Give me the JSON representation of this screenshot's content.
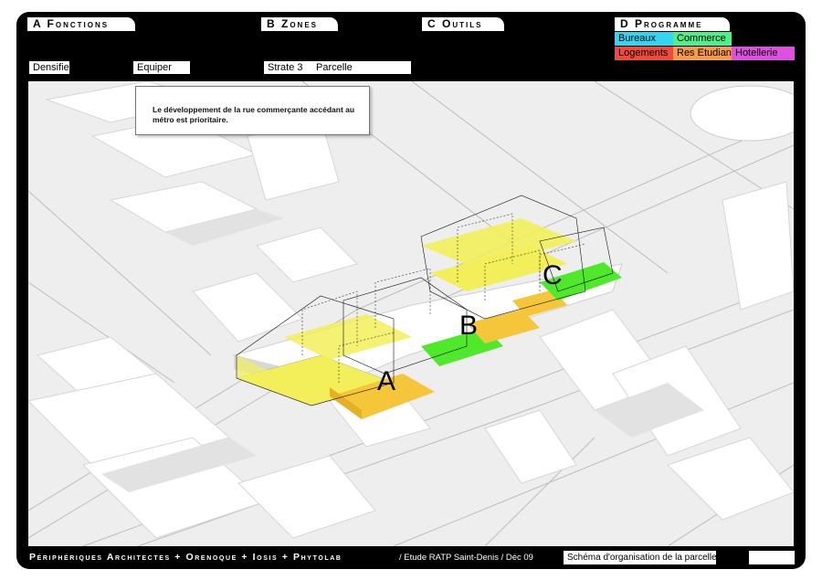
{
  "tabs": {
    "a": "A Fonctions",
    "b": "B Zones",
    "c": "C Outils",
    "d": "D Programme"
  },
  "fields": {
    "densifier": "Densifier",
    "equiper": "Equiper",
    "strate": "Strate 3",
    "parcelle": "Parcelle"
  },
  "programme": [
    {
      "label": "Bureaux",
      "color": "#33d6f0"
    },
    {
      "label": "Commerce",
      "color": "#4df08a"
    },
    {
      "label": "Logements",
      "color": "#f04a3c"
    },
    {
      "label": "Res Etudiants",
      "color": "#f79a48"
    },
    {
      "label": "Hotellerie",
      "color": "#e050e0"
    }
  ],
  "callout": "Le développement de la rue commerçante accédant au métro est prioritaire.",
  "zones": [
    "A",
    "B",
    "C"
  ],
  "footer": {
    "credit": "Périphériques Architectes + Orenoque + Iosis + Phytolab",
    "study": "/ Etude RATP Saint-Denis / Déc 09",
    "caption": "Schéma d'organisation de la parcelle",
    "blank": ""
  },
  "colors": {
    "yellow": "#f2ef5a",
    "orange": "#f5c53a",
    "green": "#4fe82a",
    "frame": "#000000"
  }
}
